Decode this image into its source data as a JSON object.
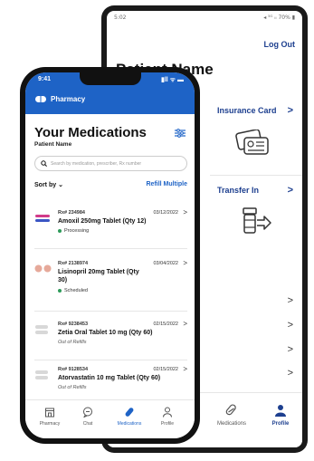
{
  "back": {
    "status_time": "5:02",
    "status_right": "◂ ⁵ᴳ ᵢᵢ 70% ▮",
    "logout": "Log Out",
    "title": "Patient Name",
    "insurance_label": "Insurance Card",
    "transfer_label": "Transfer In",
    "chevron": ">",
    "nav": {
      "medications": "Medications",
      "profile": "Profile"
    }
  },
  "front": {
    "status_time": "9:41",
    "status_icons": "▮ll ᯤ ▬",
    "brand": "Pharmacy",
    "title": "Your Medications",
    "subtitle": "Patient Name",
    "search_placeholder": "Search by medication, prescriber, Rx number",
    "sort_label": "Sort by",
    "refill_label": "Refill Multiple",
    "medications": [
      {
        "rx": "Rx# 234984",
        "date": "03/12/2022",
        "name": "Amoxil 250mg Tablet (Qty 12)",
        "status": "Processing"
      },
      {
        "rx": "Rx# 2138974",
        "date": "03/04/2022",
        "name": "Lisinopril 20mg Tablet (Qty 30)",
        "status": "Scheduled"
      },
      {
        "rx": "Rx# 9238453",
        "date": "02/15/2022",
        "name": "Zetia Oral Tablet 10 mg (Qty  60)",
        "status": "Out of Refills"
      },
      {
        "rx": "Rx# 9128534",
        "date": "02/15/2022",
        "name": "Atorvastatin 10 mg Tablet (Qty 60)",
        "status": "Out of Refills"
      }
    ],
    "nav": {
      "pharmacy": "Pharmacy",
      "chat": "Chat",
      "medications": "Medications",
      "profile": "Profile"
    }
  },
  "colors": {
    "brand_blue": "#1e63c6",
    "back_accent": "#1d3f8f",
    "processing": "#2e9b5a",
    "scheduled": "#2e9b5a"
  }
}
